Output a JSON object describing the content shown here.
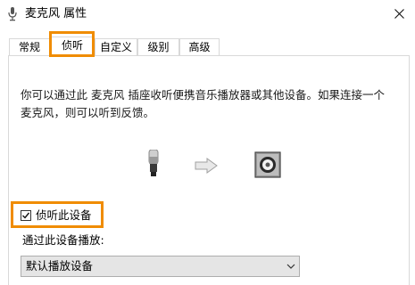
{
  "window": {
    "title": "麦克风 属性",
    "close_icon": "close-icon"
  },
  "tabs": [
    {
      "label": "常规",
      "active": false
    },
    {
      "label": "侦听",
      "active": true
    },
    {
      "label": "自定义",
      "active": false
    },
    {
      "label": "级别",
      "active": false
    },
    {
      "label": "高级",
      "active": false
    }
  ],
  "listen": {
    "description": "你可以通过此 麦克风 插座收听便携音乐播放器或其他设备。如果连接一个麦克风，则可以听到反馈。",
    "illustration": {
      "source_icon": "microphone-icon",
      "arrow_icon": "arrow-right-icon",
      "output_icon": "speaker-icon"
    },
    "listen_checkbox": {
      "label": "侦听此设备",
      "checked": true
    },
    "playback_label": "通过此设备播放:",
    "playback_device": {
      "selected": "默认播放设备"
    }
  },
  "colors": {
    "highlight": "#f08c00",
    "border": "#d9d9d9"
  }
}
